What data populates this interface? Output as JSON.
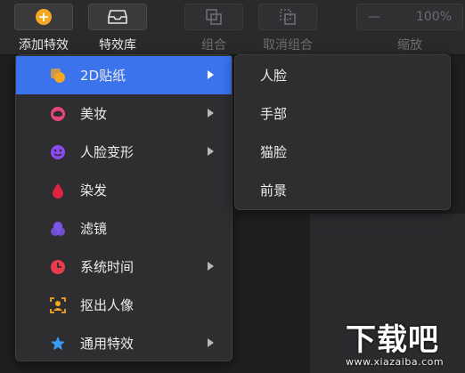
{
  "toolbar": {
    "add_effect": "添加特效",
    "effect_library": "特效库",
    "group": "组合",
    "ungroup": "取消组合",
    "zoom_label": "缩放",
    "zoom_minus": "—",
    "zoom_value": "100%"
  },
  "menu": {
    "items": [
      {
        "label": "2D贴纸",
        "icon": "sticker-icon",
        "color": "#f5a623",
        "has_sub": true
      },
      {
        "label": "美妆",
        "icon": "makeup-icon",
        "color": "#e8457a",
        "has_sub": true
      },
      {
        "label": "人脸变形",
        "icon": "face-morph-icon",
        "color": "#8a4cf0",
        "has_sub": true
      },
      {
        "label": "染发",
        "icon": "hair-dye-icon",
        "color": "#e0243f",
        "has_sub": false
      },
      {
        "label": "滤镜",
        "icon": "filter-icon",
        "color": "#7b55e8",
        "has_sub": false
      },
      {
        "label": "系统时间",
        "icon": "clock-icon",
        "color": "#ea3c4c",
        "has_sub": true
      },
      {
        "label": "抠出人像",
        "icon": "portrait-cutout-icon",
        "color": "#f5a623",
        "has_sub": false
      },
      {
        "label": "通用特效",
        "icon": "star-icon",
        "color": "#3a9bf2",
        "has_sub": true
      }
    ]
  },
  "submenu": {
    "items": [
      "人脸",
      "手部",
      "猫脸",
      "前景"
    ]
  },
  "watermark": {
    "big": "下载吧",
    "small": "www.xiazaiba.com"
  }
}
